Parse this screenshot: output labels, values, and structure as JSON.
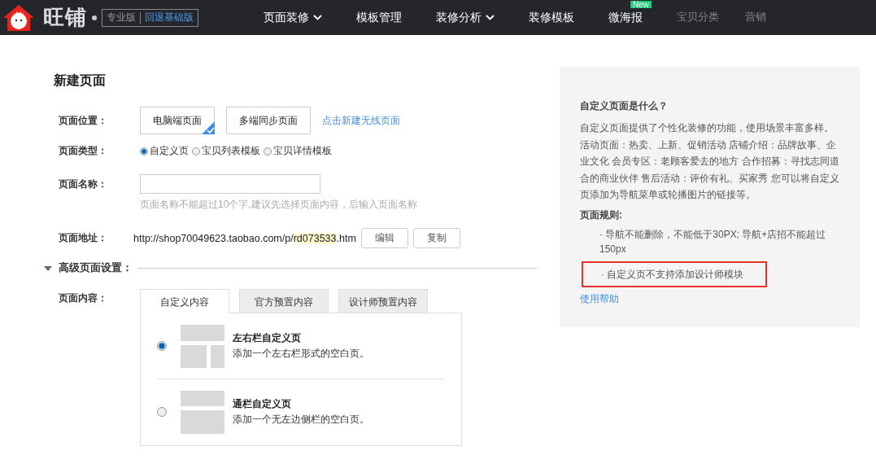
{
  "header": {
    "logo_text": "旺铺",
    "edition": "专业版",
    "downgrade_link": "回退基础版",
    "nav": [
      {
        "label": "页面装修",
        "dropdown": true,
        "disabled": false
      },
      {
        "label": "模板管理",
        "dropdown": false,
        "disabled": false
      },
      {
        "label": "装修分析",
        "dropdown": true,
        "disabled": false
      },
      {
        "label": "装修模板",
        "dropdown": false,
        "disabled": false
      },
      {
        "label": "微海报",
        "dropdown": false,
        "disabled": false,
        "badge": "New"
      },
      {
        "label": "宝贝分类",
        "dropdown": false,
        "disabled": true
      },
      {
        "label": "营销",
        "dropdown": false,
        "disabled": true
      }
    ]
  },
  "form": {
    "title": "新建页面",
    "position": {
      "label": "页面位置：",
      "options": [
        {
          "label": "电脑端页面",
          "selected": true
        },
        {
          "label": "多端同步页面",
          "selected": false
        }
      ],
      "link": "点击新建无线页面"
    },
    "type": {
      "label": "页面类型：",
      "options": [
        {
          "label": "自定义页",
          "selected": true
        },
        {
          "label": "宝贝列表模板",
          "selected": false
        },
        {
          "label": "宝贝详情模板",
          "selected": false
        }
      ]
    },
    "name": {
      "label": "页面名称：",
      "hint": "页面名称不能超过10个字,建议先选择页面内容，后输入页面名称"
    },
    "address": {
      "label": "页面地址：",
      "url_prefix": "http://shop70049623.taobao.com/p/",
      "url_highlight": "rd073533",
      "url_suffix": ".htm",
      "buttons": [
        "编辑",
        "复制"
      ]
    },
    "advanced": {
      "label": "高级页面设置：",
      "expanded": true
    },
    "content": {
      "label": "页面内容：",
      "tabs": [
        {
          "label": "自定义内容",
          "selected": true
        },
        {
          "label": "官方预置内容",
          "selected": false
        },
        {
          "label": "设计师预置内容",
          "selected": false
        }
      ],
      "options": [
        {
          "kind": "two-column",
          "title": "左右栏自定义页",
          "description": "添加一个左右栏形式的空白页。",
          "selected": true
        },
        {
          "kind": "full-width",
          "title": "通栏自定义页",
          "description": "添加一个无左边侧栏的空白页。",
          "selected": false
        }
      ]
    }
  },
  "help": {
    "title": "自定义页面是什么？",
    "body": "自定义页面提供了个性化装修的功能，使用场景丰富多样。活动页面：热卖、上新、促销活动 店铺介绍：品牌故事、企业文化 会员专区：老顾客爱去的地方 合作招募：寻找志同道合的商业伙伴 售后活动：评价有礼、买家秀 您可以将自定义页添加为导航菜单或轮播图片的链接等。",
    "rules_title": "页面规则:",
    "rules": [
      {
        "text": "· 导航不能删除，不能低于30PX; 导航+店招不能超过150px",
        "highlighted": false
      },
      {
        "text": "· 自定义页不支持添加设计师模块",
        "highlighted": true
      }
    ],
    "help_link": "使用帮助"
  }
}
